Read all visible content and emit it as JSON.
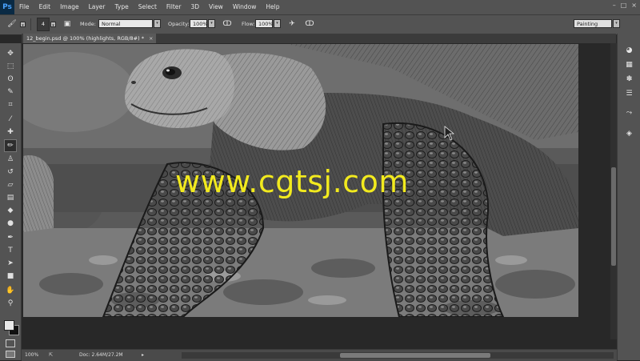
{
  "app": {
    "logo": "Ps"
  },
  "menu": [
    "File",
    "Edit",
    "Image",
    "Layer",
    "Type",
    "Select",
    "Filter",
    "3D",
    "View",
    "Window",
    "Help"
  ],
  "window_controls": [
    "–",
    "□",
    "×"
  ],
  "options": {
    "brush_size": "4",
    "mode_label": "Mode:",
    "mode_value": "Normal",
    "opacity_label": "Opacity:",
    "opacity_value": "100%",
    "flow_label": "Flow:",
    "flow_value": "100%",
    "workspace": "Painting"
  },
  "document_tab": {
    "title": "12_begin.psd @ 100% (highlights, RGB/8#) *",
    "close": "×"
  },
  "watermark": "www.cgtsj.com",
  "status": {
    "zoom": "100%",
    "doc": "Doc: 2.64M/27.2M",
    "arrow": "▸"
  },
  "tools": [
    {
      "name": "move-tool",
      "icon": "✥"
    },
    {
      "name": "marquee-tool",
      "icon": "⬚"
    },
    {
      "name": "lasso-tool",
      "icon": "ʘ"
    },
    {
      "name": "quick-selection-tool",
      "icon": "✎"
    },
    {
      "name": "crop-tool",
      "icon": "⌗"
    },
    {
      "name": "eyedropper-tool",
      "icon": "⁄"
    },
    {
      "name": "healing-brush-tool",
      "icon": "✚"
    },
    {
      "name": "brush-tool",
      "icon": "✏"
    },
    {
      "name": "clone-stamp-tool",
      "icon": "♙"
    },
    {
      "name": "history-brush-tool",
      "icon": "↺"
    },
    {
      "name": "eraser-tool",
      "icon": "▱"
    },
    {
      "name": "gradient-tool",
      "icon": "▤"
    },
    {
      "name": "blur-tool",
      "icon": "◆"
    },
    {
      "name": "dodge-tool",
      "icon": "●"
    },
    {
      "name": "pen-tool",
      "icon": "✒"
    },
    {
      "name": "type-tool",
      "icon": "T"
    },
    {
      "name": "path-selection-tool",
      "icon": "➤"
    },
    {
      "name": "rectangle-tool",
      "icon": "■"
    },
    {
      "name": "hand-tool",
      "icon": "✋"
    },
    {
      "name": "zoom-tool",
      "icon": "⚲"
    }
  ],
  "panels": [
    {
      "name": "color-panel-icon",
      "icon": "◕"
    },
    {
      "name": "swatches-panel-icon",
      "icon": "▦"
    },
    {
      "name": "brush-panel-icon",
      "icon": "✽"
    },
    {
      "name": "adjustments-panel-icon",
      "icon": "☰"
    },
    {
      "name": "paths-panel-icon",
      "icon": "⤳"
    },
    {
      "name": "layers-panel-icon",
      "icon": "◈"
    }
  ]
}
